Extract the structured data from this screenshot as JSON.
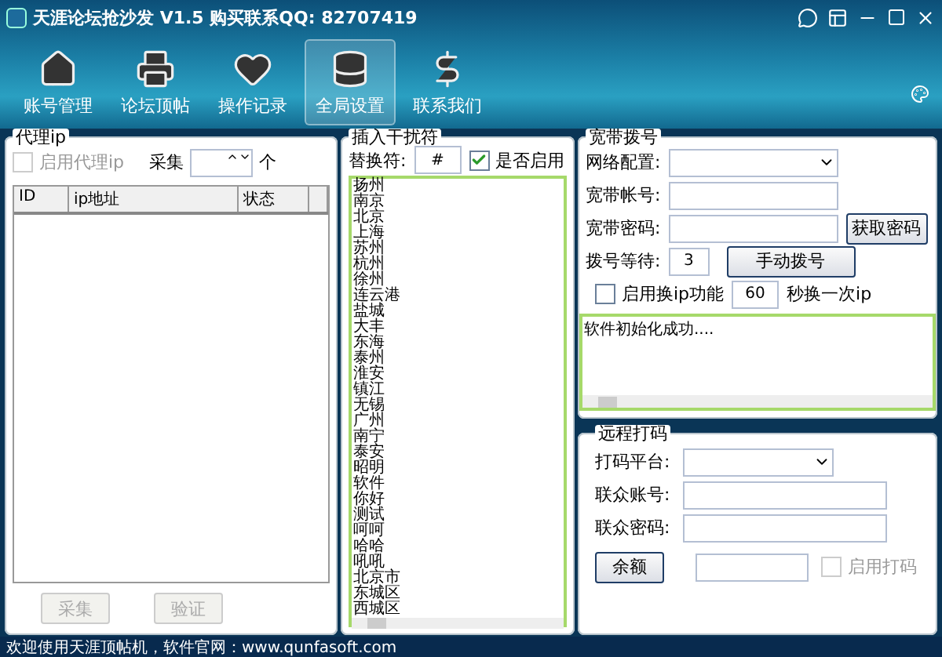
{
  "window": {
    "title": "天涯论坛抢沙发 V1.5 购买联系QQ: 82707419"
  },
  "toolbar": [
    {
      "label": "账号管理",
      "kind": "home",
      "selected": false
    },
    {
      "label": "论坛顶帖",
      "kind": "printer",
      "selected": false
    },
    {
      "label": "操作记录",
      "kind": "heart",
      "selected": false
    },
    {
      "label": "全局设置",
      "kind": "stack",
      "selected": true
    },
    {
      "label": "联系我们",
      "kind": "dollar",
      "selected": false
    }
  ],
  "proxy_panel": {
    "title": "代理ip",
    "enable": {
      "label": "启用代理ip",
      "checked": false,
      "disabled": true
    },
    "collect_label": "采集",
    "unit": "个",
    "table": {
      "columns": [
        "ID",
        "ip地址",
        "状态"
      ]
    },
    "buttons": [
      {
        "label": "采集",
        "disabled": true
      },
      {
        "label": "验证",
        "disabled": true
      }
    ]
  },
  "interference_panel": {
    "title": "插入干扰符",
    "replace_label": "替换符:",
    "replace_value": "#",
    "enable": {
      "label": "是否启用",
      "checked": true
    },
    "lines": [
      "扬州",
      "南京",
      "北京",
      "上海",
      "苏州",
      "杭州",
      "徐州",
      "连云港",
      "盐城",
      "大丰",
      "东海",
      "泰州",
      "淮安",
      "镇江",
      "无锡",
      "广州",
      "南宁",
      "泰安",
      "昭明",
      "软件",
      "你好",
      "测试",
      "呵呵",
      "哈哈",
      "吼吼",
      "北京市",
      "东城区",
      "西城区"
    ]
  },
  "broadband_panel": {
    "title": "宽带拨号",
    "network": {
      "label": "网络配置:"
    },
    "account": {
      "label": "宽带帐号:"
    },
    "password": {
      "label": "宽带密码:",
      "button": "获取密码"
    },
    "dial_wait": {
      "label": "拨号等待:",
      "value": "3",
      "button": "手动拨号"
    },
    "ip_switch": {
      "label": "启用换ip功能",
      "checked": false,
      "value": "60",
      "suffix": "秒换一次ip"
    },
    "log": "软件初始化成功...."
  },
  "remote_panel": {
    "title": "远程打码",
    "platform": {
      "label": "打码平台:"
    },
    "account": {
      "label": "联众账号:"
    },
    "password": {
      "label": "联众密码:"
    },
    "balance_button": "余额",
    "enable": {
      "label": "启用打码",
      "checked": false,
      "disabled": true
    }
  },
  "status_bar": "欢迎使用天涯顶帖机，软件官网：www.qunfasoft.com"
}
